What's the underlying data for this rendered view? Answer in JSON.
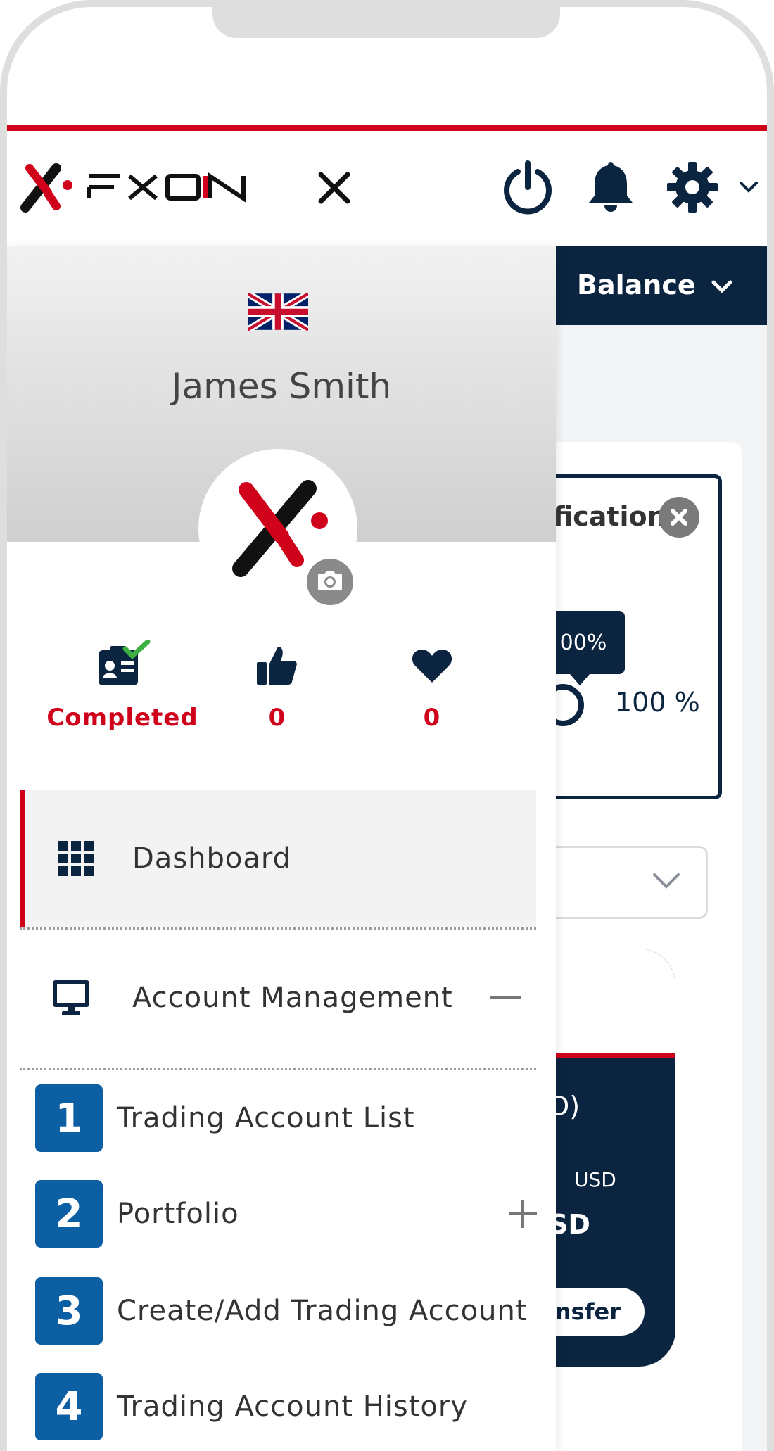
{
  "brand": {
    "name": "FXON",
    "accent": "#d0021b",
    "navy": "#0b2440",
    "badge_blue": "#0d5fa3"
  },
  "header": {
    "close_icon": "close-icon",
    "power_icon": "power-icon",
    "bell_icon": "bell-icon",
    "gear_icon": "gear-icon",
    "dropdown_icon": "chevron-down-icon"
  },
  "background": {
    "balance_label": "Balance",
    "verification_title": "fication",
    "percent_tooltip": "00%",
    "percent_label": "100 %",
    "account_currency_title": "D)",
    "account_currency_small": "USD",
    "account_balance_big": "SD",
    "transfer_label": "nsfer"
  },
  "drawer": {
    "user_name": "James Smith",
    "flag": "uk-flag",
    "stats": [
      {
        "icon": "id-card-check-icon",
        "value": "Completed"
      },
      {
        "icon": "thumbs-up-icon",
        "value": "0"
      },
      {
        "icon": "heart-icon",
        "value": "0"
      }
    ],
    "menu": [
      {
        "label": "Dashboard",
        "icon": "grid-icon",
        "active": true
      },
      {
        "label": "Account Management",
        "icon": "monitor-icon",
        "expanded": true,
        "toggle": "minus-icon"
      }
    ],
    "sub_items": [
      {
        "number": "1",
        "label": "Trading Account List"
      },
      {
        "number": "2",
        "label": "Portfolio",
        "toggle": "plus-icon"
      },
      {
        "number": "3",
        "label": "Create/Add Trading Account"
      },
      {
        "number": "4",
        "label": "Trading Account History"
      }
    ]
  }
}
